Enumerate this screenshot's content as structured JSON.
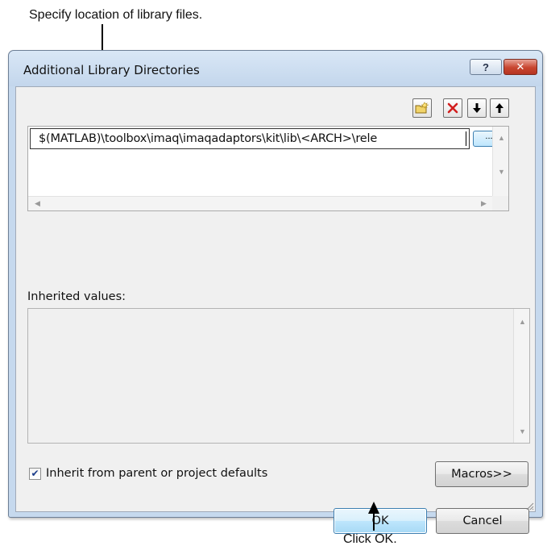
{
  "annotations": {
    "top_callout": "Specify location of library files.",
    "bottom_callout": "Click OK."
  },
  "window": {
    "title": "Additional Library Directories",
    "help_label": "?",
    "close_label": "✕"
  },
  "toolbar": {
    "new_line_icon": "new-folder-icon",
    "delete_icon": "delete-icon",
    "move_down_icon": "arrow-down-icon",
    "move_up_icon": "arrow-up-icon"
  },
  "directories": {
    "entries": [
      "$(MATLAB)\\toolbox\\imaq\\imaqadaptors\\kit\\lib\\<ARCH>\\rele"
    ],
    "browse_label": "..."
  },
  "inherited": {
    "label": "Inherited values:"
  },
  "options": {
    "inherit_label": "Inherit from parent or project defaults",
    "inherit_checked": true
  },
  "buttons": {
    "macros": "Macros>>",
    "ok": "OK",
    "cancel": "Cancel"
  },
  "colors": {
    "frame": "#c6d9ee",
    "close_button": "#c8452f",
    "default_button_border": "#3c7fb1"
  }
}
